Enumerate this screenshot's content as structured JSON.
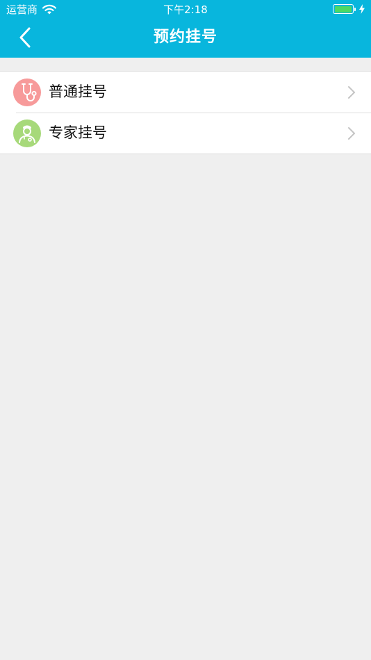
{
  "status_bar": {
    "carrier": "运营商",
    "time": "下午2:18",
    "battery_level": 1.0
  },
  "nav": {
    "title": "预约挂号",
    "back_icon": "chevron-left-icon"
  },
  "menu": {
    "items": [
      {
        "label": "普通挂号",
        "icon": "stethoscope-icon",
        "icon_bg": "#f79a9a"
      },
      {
        "label": "专家挂号",
        "icon": "doctor-icon",
        "icon_bg": "#a7d97a"
      }
    ]
  },
  "colors": {
    "header": "#08b6dd",
    "background": "#efefef",
    "battery_fill": "#4cd964"
  }
}
